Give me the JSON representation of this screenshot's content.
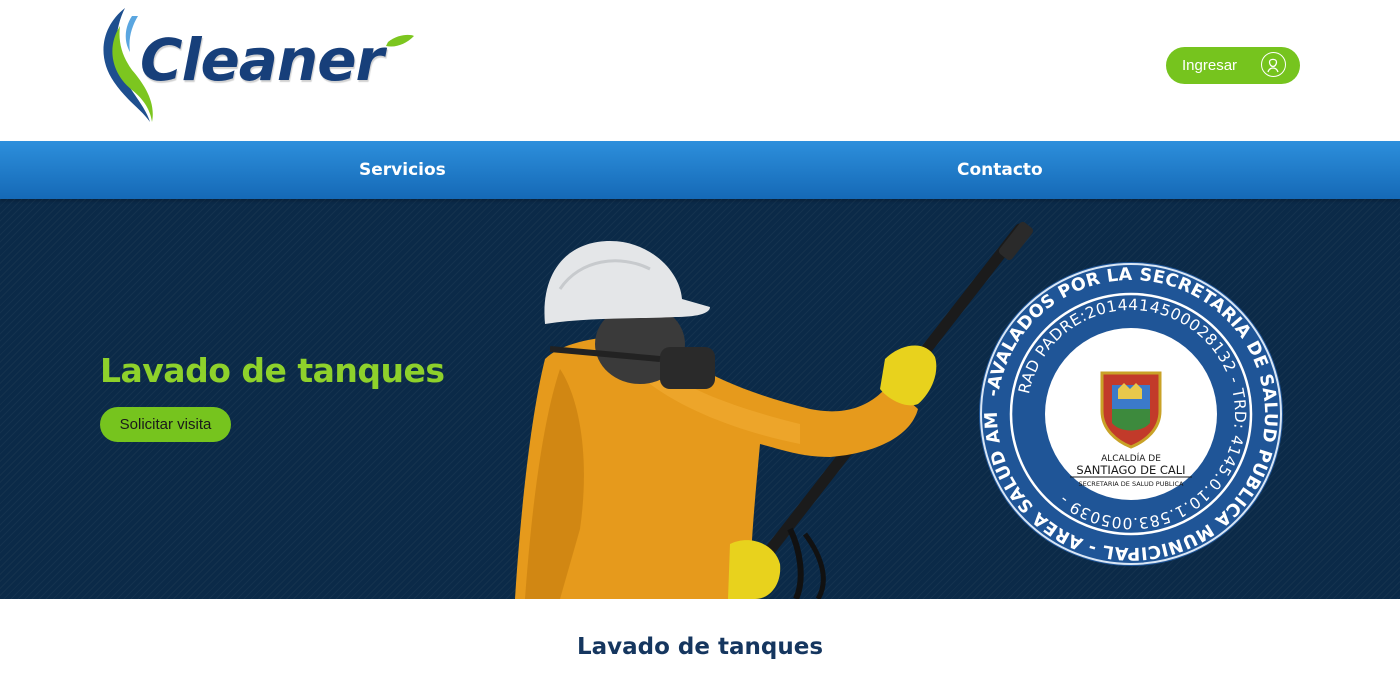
{
  "header": {
    "logo_text": "Cleaner",
    "login_label": "Ingresar",
    "login_icon": "user-icon"
  },
  "nav": {
    "items": [
      {
        "label": "Servicios"
      },
      {
        "label": "Contacto"
      }
    ]
  },
  "hero": {
    "title": "Lavado de tanques",
    "cta_label": "Solicitar visita",
    "seal": {
      "outer_text": "-AVALADOS POR LA SECRETARIA DE SALUD PUBLICA MUNICIPAL - AREA SALUD AMBIENTAL",
      "inner_text": "RAD PADRE:2014414500028132 - TRD: 4145.0.10.1.583.005039 -",
      "line1": "ALCALDÍA DE",
      "line2": "SANTIAGO DE CALI",
      "line3": "SECRETARIA DE SALUD PUBLICA"
    }
  },
  "section": {
    "title": "Lavado de tanques"
  },
  "colors": {
    "brand_blue": "#173f7a",
    "accent_green": "#76c41e",
    "title_green": "#8ed12b",
    "nav_blue": "#1f7acb",
    "hero_bg": "#0b2a48",
    "seal_blue": "#1f5597"
  }
}
